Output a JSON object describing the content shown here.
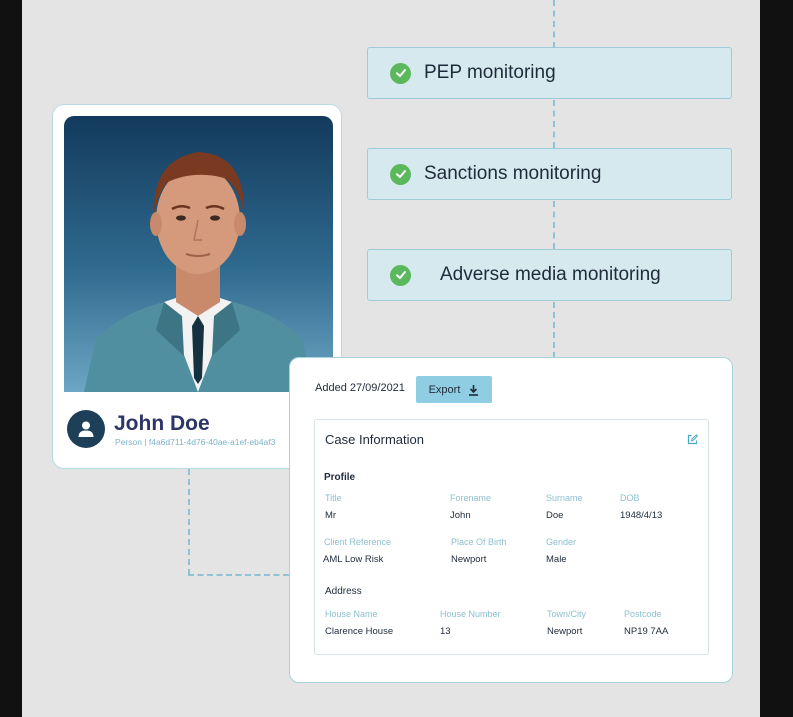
{
  "monitoring": [
    {
      "label": "PEP monitoring"
    },
    {
      "label": "Sanctions monitoring"
    },
    {
      "label": "Adverse media monitoring"
    }
  ],
  "person": {
    "name": "John Doe",
    "subtitle": "Person | f4a6d711-4d76-40ae-a1ef-eb4af3"
  },
  "case": {
    "added": "Added 27/09/2021",
    "export_label": "Export",
    "title": "Case Information",
    "profile_heading": "Profile",
    "profile_fields": [
      {
        "label": "Title",
        "value": "Mr"
      },
      {
        "label": "Forename",
        "value": "John"
      },
      {
        "label": "Surname",
        "value": "Doe"
      },
      {
        "label": "DOB",
        "value": "1948/4/13"
      },
      {
        "label": "Client Reference",
        "value": "AML Low Risk"
      },
      {
        "label": "Place Of Birth",
        "value": "Newport"
      },
      {
        "label": "Gender",
        "value": "Male"
      }
    ],
    "address_heading": "Address",
    "address_fields": [
      {
        "label": "House Name",
        "value": "Clarence House"
      },
      {
        "label": "House Number",
        "value": "13"
      },
      {
        "label": "Town/City",
        "value": "Newport"
      },
      {
        "label": "Postcode",
        "value": "NP19 7AA"
      }
    ]
  },
  "colors": {
    "accent": "#8fcde2",
    "check": "#5cb85c",
    "name": "#2b3566"
  }
}
